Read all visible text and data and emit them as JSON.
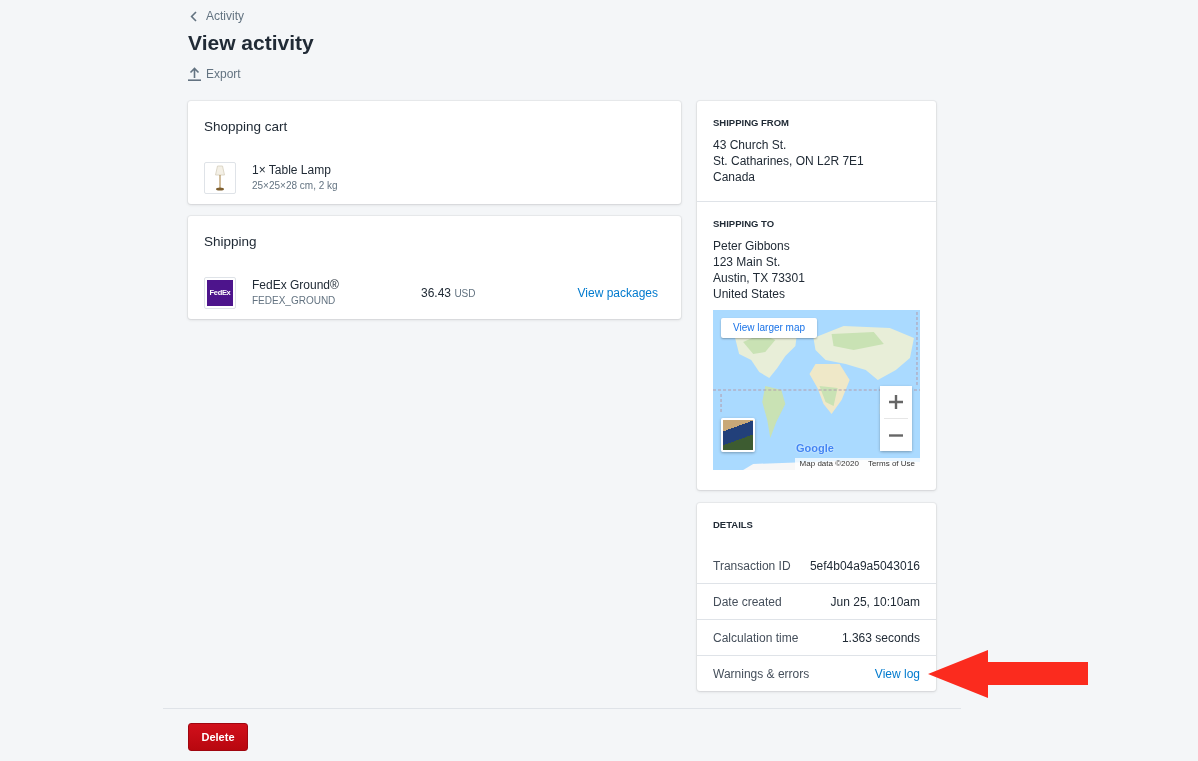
{
  "breadcrumb": {
    "label": "Activity"
  },
  "title": "View activity",
  "actions": [
    {
      "label": "Export"
    }
  ],
  "shopping_cart": {
    "title": "Shopping cart",
    "items": [
      {
        "name": "1× Table Lamp",
        "details": "25×25×28 cm, 2 kg"
      }
    ]
  },
  "shipping": {
    "title": "Shipping",
    "rates": [
      {
        "carrier_logo": "FedEx",
        "service": "FedEx Ground®",
        "code": "FEDEX_GROUND",
        "price": "36.43",
        "currency": "USD",
        "link": "View packages"
      }
    ]
  },
  "addresses": [
    {
      "heading": "SHIPPING FROM",
      "lines": [
        "43 Church St.",
        "St. Catharines, ON L2R 7E1",
        "Canada"
      ]
    },
    {
      "heading": "SHIPPING TO",
      "lines": [
        "Peter Gibbons",
        "123 Main St.",
        "Austin, TX 73301",
        "United States"
      ],
      "map": {
        "button": "View larger map",
        "logo": "Google",
        "attribution": "Map data ©2020",
        "terms": "Terms of Use"
      }
    }
  ],
  "details": {
    "heading": "DETAILS",
    "rows": [
      {
        "label": "Transaction ID",
        "value": "5ef4b04a9a5043016",
        "kind": "text",
        "pointer": false
      },
      {
        "label": "Date created",
        "value": "Jun 25, 10:10am",
        "kind": "text",
        "pointer": false
      },
      {
        "label": "Calculation time",
        "value": "1.363 seconds",
        "kind": "text",
        "pointer": false
      },
      {
        "label": "Warnings & errors",
        "value": "View log",
        "kind": "link",
        "pointer": true
      }
    ]
  },
  "footer": {
    "delete_button": "Delete"
  }
}
